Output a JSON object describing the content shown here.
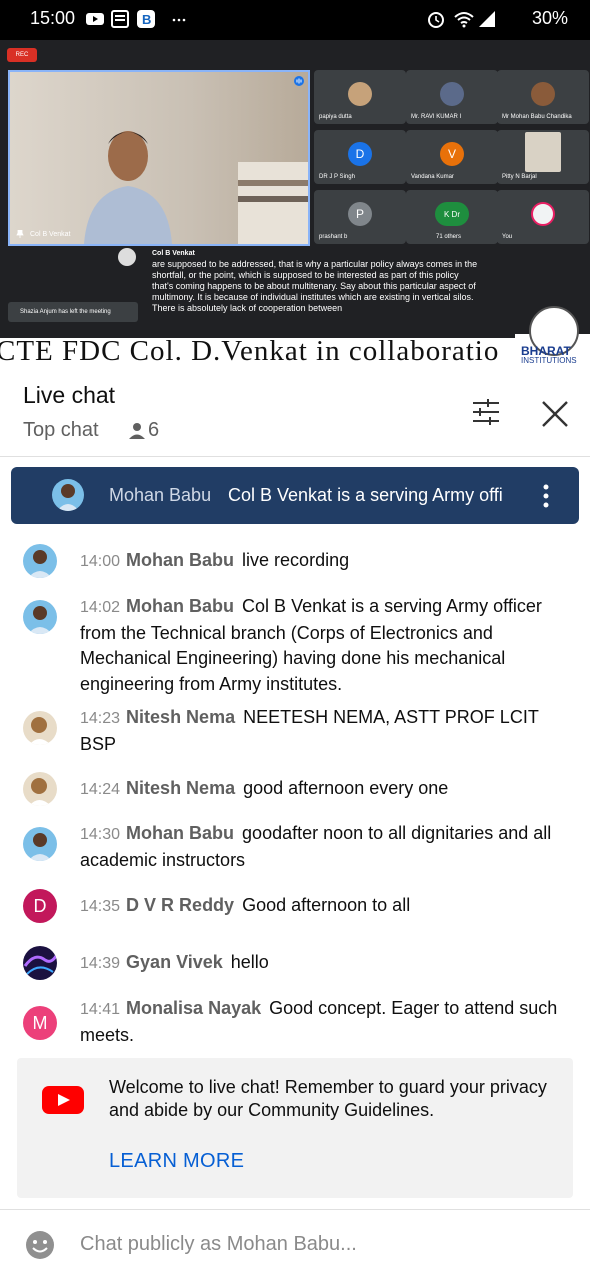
{
  "status_bar": {
    "time": "15:00",
    "battery": "30%"
  },
  "video": {
    "rec_label": "REC",
    "speaker_name": "Col B Venkat",
    "participants": [
      {
        "name": "papiya dutta",
        "initial": "",
        "color": "#c6a27a"
      },
      {
        "name": "Mr. RAVI KUMAR I",
        "initial": "",
        "color": "#5b6a8a"
      },
      {
        "name": "Mr Mohan Babu Chandika",
        "initial": "",
        "color": "#8a5b3a"
      },
      {
        "name": "DR J P Singh",
        "initial": "D",
        "color": "#1a73e8"
      },
      {
        "name": "Vandana Kumar",
        "initial": "V",
        "color": "#e8710a"
      },
      {
        "name": "Pitty N Barjal",
        "initial": "",
        "color": "#d9d2c5"
      },
      {
        "name": "prashant b",
        "initial": "P",
        "color": "#80868b"
      },
      {
        "name": "71 others",
        "initial": "K Dr",
        "color": "#1e8e3e"
      },
      {
        "name": "You",
        "initial": "",
        "color": "#f1f3f4"
      }
    ],
    "caption_name": "Col B Venkat",
    "caption_text": "are supposed to be addressed, that is why a particular policy always comes in the shortfall, or the point, which is supposed to be interested as part of this policy that's coming happens to be about multitenary. Say about this particular aspect of multimony. It is because of individual institutes which are existing in vertical silos. There is absolutely lack of cooperation between",
    "toast": "Shazia Anjum has left the meeting",
    "banner_text": "CTE FDC Col. D.Venkat in collaboratio",
    "logo_line1": "BHARAT",
    "logo_line2": "INSTITUTIONS"
  },
  "chat_header": {
    "title": "Live chat",
    "mode": "Top chat",
    "viewer_count": "6"
  },
  "pinned": {
    "author": "Mohan Babu",
    "message": "Col B Venkat is a serving Army offi"
  },
  "messages": [
    {
      "time": "14:00",
      "author": "Mohan Babu",
      "text": "live recording"
    },
    {
      "time": "14:02",
      "author": "Mohan Babu",
      "text": "Col B Venkat is a serving Army officer from the Technical branch (Corps of Electronics and Mechanical Engineering) having done his mechanical engineering from Army institutes."
    },
    {
      "time": "14:23",
      "author": "Nitesh Nema",
      "text": "NEETESH NEMA, ASTT PROF LCIT BSP"
    },
    {
      "time": "14:24",
      "author": "Nitesh Nema",
      "text": "good afternoon every one"
    },
    {
      "time": "14:30",
      "author": "Mohan Babu",
      "text": "goodafter noon to all dignitaries and all academic instructors"
    },
    {
      "time": "14:35",
      "author": "D V R Reddy",
      "text": "Good afternoon to all",
      "avatar_letter": "D",
      "avatar_color": "#c2185b"
    },
    {
      "time": "14:39",
      "author": "Gyan Vivek",
      "text": "hello"
    },
    {
      "time": "14:41",
      "author": "Monalisa Nayak",
      "text": "Good concept. Eager to attend such meets.",
      "avatar_letter": "M",
      "avatar_color": "#ec407a"
    }
  ],
  "welcome": {
    "text": "Welcome to live chat! Remember to guard your privacy and abide by our Community Guidelines.",
    "link": "LEARN MORE"
  },
  "input": {
    "placeholder": "Chat publicly as Mohan Babu..."
  }
}
